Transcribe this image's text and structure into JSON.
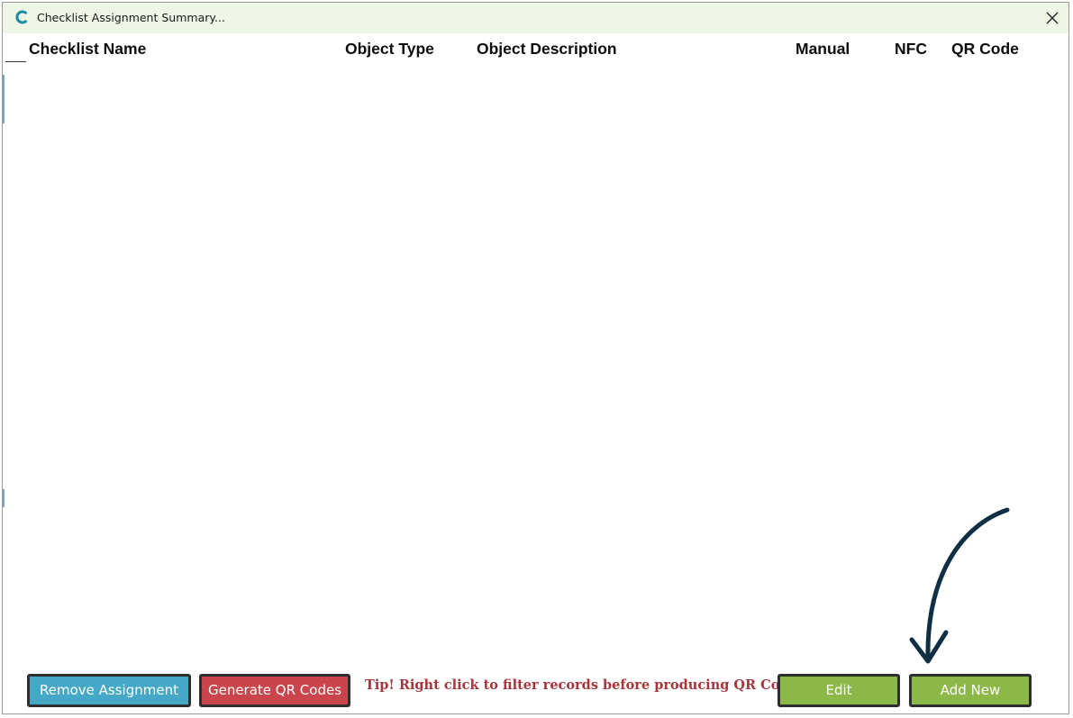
{
  "window": {
    "title": "Checklist Assignment Summary..."
  },
  "grid": {
    "columns": [
      {
        "label": "Checklist Name"
      },
      {
        "label": "Object Type"
      },
      {
        "label": "Object Description"
      },
      {
        "label": "Manual"
      },
      {
        "label": "NFC"
      },
      {
        "label": "QR Code"
      }
    ],
    "rows": []
  },
  "footer": {
    "remove_label": "Remove Assignment",
    "generate_label": "Generate QR Codes",
    "tip": "Tip! Right click to filter records before producing QR Codes",
    "edit_label": "Edit",
    "add_label": "Add New"
  },
  "icons": {
    "app": "app-logo-icon",
    "close": "close-icon",
    "arrow": "curved-arrow-annotation"
  },
  "colors": {
    "titlebar_bg": "#eef7e6",
    "remove_button": "#45a8c6",
    "generate_button": "#c9454b",
    "green_button": "#8cb84a",
    "tip_text": "#a8353c",
    "arrow": "#0f2f45",
    "app_icon": "#1a8aaa"
  }
}
